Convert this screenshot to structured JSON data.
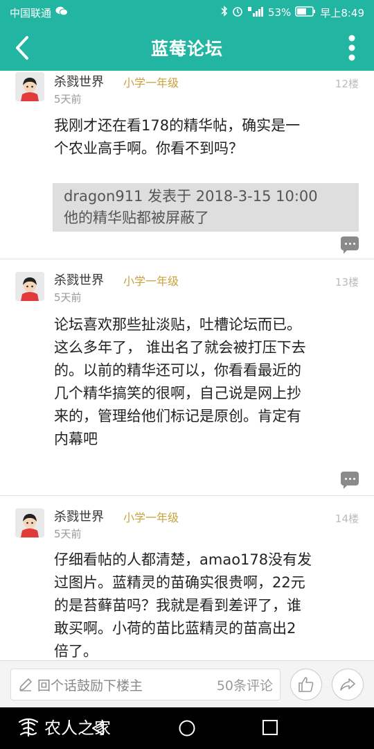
{
  "status_bar": {
    "carrier": "中国联通",
    "battery": "53%",
    "time": "早上8:49"
  },
  "app_bar": {
    "title": "蓝莓论坛"
  },
  "posts": [
    {
      "username": "杀戮世界",
      "grade": "小学一年级",
      "time": "5天前",
      "floor": "12楼",
      "lines": [
        "我刚才还在看178的精华帖，确实是一",
        "个农业高手啊。你看不到吗？"
      ],
      "quote": {
        "header": "dragon911 发表于 2018-3-15 10:00",
        "text": "他的精华贴都被屏蔽了"
      }
    },
    {
      "username": "杀戮世界",
      "grade": "小学一年级",
      "time": "5天前",
      "floor": "13楼",
      "lines": [
        "论坛喜欢那些扯淡贴，吐槽论坛而已。",
        "这么多年了， 谁出名了就会被打压下去",
        "的。以前的精华还可以，你看看最近的",
        "几个精华搞笑的很啊，自己说是网上抄",
        "来的，管理给他们标记是原创。肯定有",
        "内幕吧"
      ]
    },
    {
      "username": "杀戮世界",
      "grade": "小学一年级",
      "time": "5天前",
      "floor": "14楼",
      "lines": [
        "仔细看帖的人都清楚，amao178没有发",
        "过图片。蓝精灵的苗确实很贵啊，22元",
        "的是苔藓苗吗？我就是看到差评了，谁",
        "敢买啊。小荷的苗比蓝精灵的苗高出2",
        "倍了。"
      ]
    }
  ],
  "bottom_bar": {
    "reply_placeholder": "回个话鼓励下楼主",
    "comment_count": "50条评论"
  },
  "watermark": {
    "text": "农人之家"
  },
  "colors": {
    "accent": "#22b6a2",
    "grade": "#c9a23d"
  }
}
